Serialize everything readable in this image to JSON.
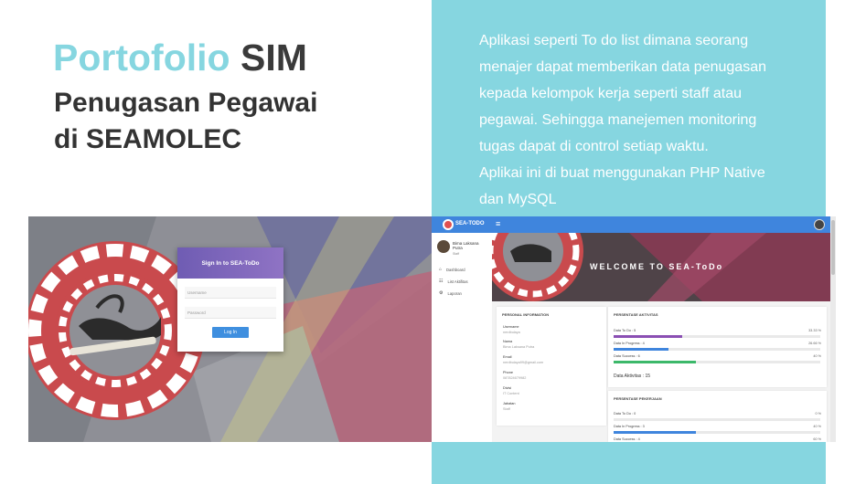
{
  "slide": {
    "title_accent": "Portofolio",
    "title_rest": "SIM",
    "subtitle_line1": "Penugasan Pegawai",
    "subtitle_line2": "di SEAMOLEC",
    "description": [
      "Aplikasi seperti To do list dimana seorang",
      "menajer dapat memberikan data penugasan",
      "kepada kelompok kerja seperti staff atau",
      "pegawai. Sehingga manejemen monitoring",
      "tugas dapat  di control setiap waktu.",
      "Aplikai ini di buat menggunakan PHP Native",
      "dan MySQL"
    ],
    "colors": {
      "accent": "#86d6e0",
      "title": "#3a3a3a"
    }
  },
  "login": {
    "header": "Sign In to SEA-ToDo",
    "username_placeholder": "Username",
    "password_placeholder": "Password",
    "button": "Log In"
  },
  "dashboard": {
    "brand": "SEA-TODO",
    "menu_icon": "hamburger-icon",
    "user": {
      "name": "Bima Laksana Putra",
      "role": "Staff"
    },
    "sidebar": [
      {
        "label": "Dashboard",
        "icon": "home-icon"
      },
      {
        "label": "List Aktifitas",
        "icon": "users-icon"
      },
      {
        "label": "Laporan",
        "icon": "gear-icon"
      }
    ],
    "banner": "WELCOME TO SEA-ToDo",
    "personal": {
      "title": "PERSONAL INFORMATION",
      "fields": [
        {
          "label": "Username",
          "value": "nerdbulaya"
        },
        {
          "label": "Nama",
          "value": "Bima Laksana Putra"
        },
        {
          "label": "Email",
          "value": "nerdbulaya99@gmail.com"
        },
        {
          "label": "Phone",
          "value": "087824679982"
        },
        {
          "label": "Divisi",
          "value": "IT Content"
        },
        {
          "label": "Jabatan",
          "value": "Staff"
        }
      ]
    },
    "activities": {
      "title": "PERSENTASE AKTIVITAS",
      "bars": [
        {
          "label": "Data To Do : 5",
          "pct": "33.33 %",
          "value": 33.33,
          "color": "#8a4fb3"
        },
        {
          "label": "Data In Progress : 4",
          "pct": "26.66 %",
          "value": 26.66,
          "color": "#3f85dd"
        },
        {
          "label": "Data Success : 6",
          "pct": "40 %",
          "value": 40,
          "color": "#3cb86a"
        }
      ],
      "total": "Data Aktivitas : 15"
    },
    "tasks": {
      "title": "PERSENTASE PEKERJAAN",
      "bars": [
        {
          "label": "Data To Do : 0",
          "pct": "0 %",
          "value": 0,
          "color": "#8a4fb3"
        },
        {
          "label": "Data In Progress : 3",
          "pct": "40 %",
          "value": 40,
          "color": "#3f85dd"
        },
        {
          "label": "Data Success : 4",
          "pct": "60 %",
          "value": 60,
          "color": "#3cb86a"
        }
      ]
    }
  }
}
